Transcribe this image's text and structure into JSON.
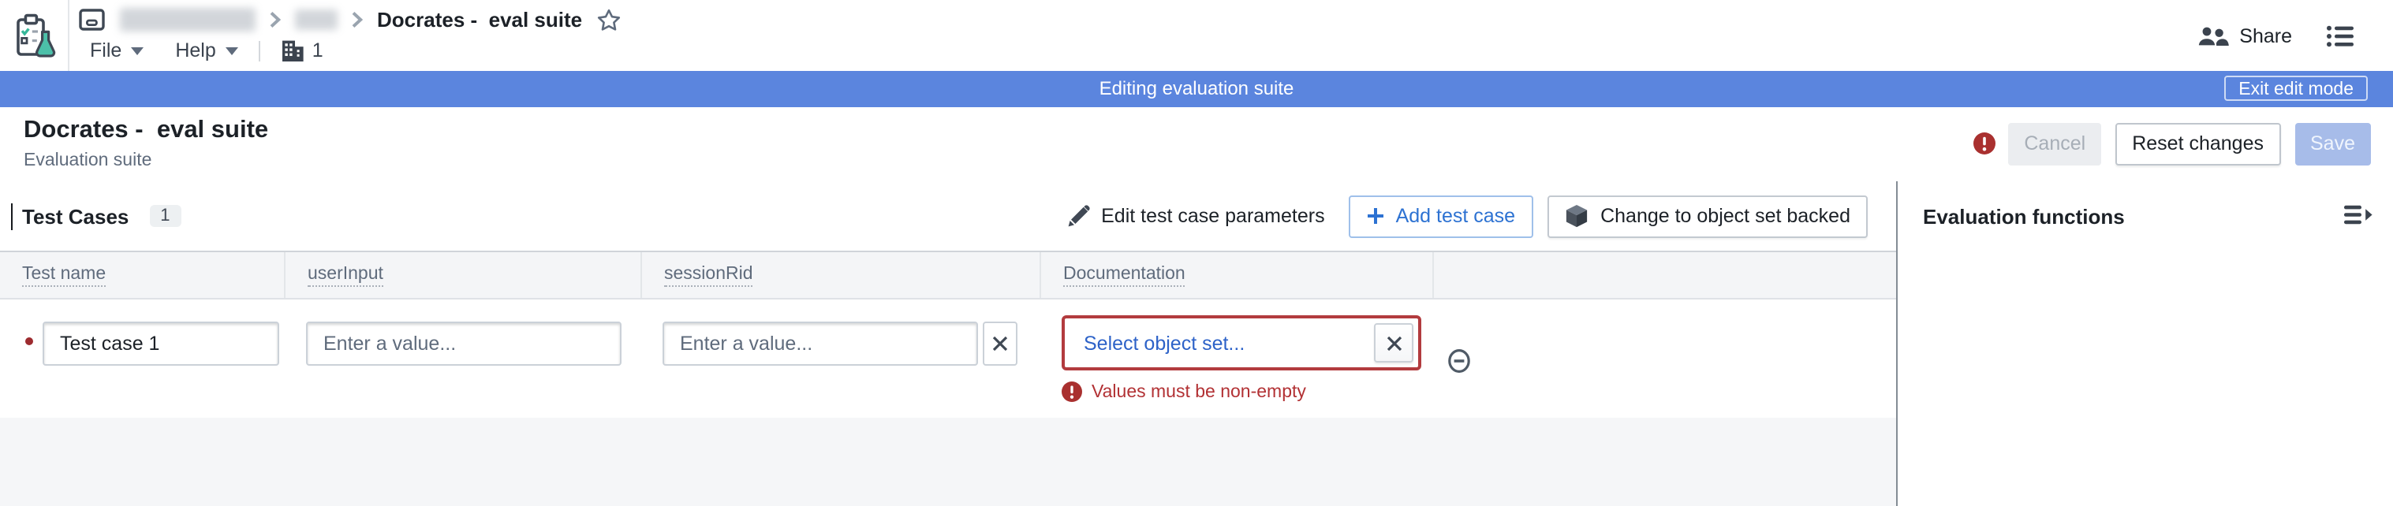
{
  "topbar": {
    "breadcrumb": {
      "title": "Docrates -  eval suite"
    },
    "menu": {
      "file": "File",
      "help": "Help"
    },
    "branch_count": "1",
    "share_label": "Share"
  },
  "banner": {
    "message": "Editing evaluation suite",
    "exit_button": "Exit edit mode"
  },
  "header": {
    "title": "Docrates -  eval suite",
    "subtitle": "Evaluation suite",
    "cancel_button": "Cancel",
    "reset_button": "Reset changes",
    "save_button": "Save"
  },
  "toolbar": {
    "section_title": "Test Cases",
    "test_case_count": "1",
    "edit_params_button": "Edit test case parameters",
    "add_button": "Add test case",
    "change_backed_button": "Change to object set backed"
  },
  "panel": {
    "title": "Evaluation functions"
  },
  "table": {
    "columns": [
      "Test name",
      "userInput",
      "sessionRid",
      "Documentation"
    ],
    "row": {
      "test_name": "Test case 1",
      "user_input_placeholder": "Enter a value...",
      "session_rid_placeholder": "Enter a value...",
      "object_set_placeholder": "Select object set...",
      "error": "Values must be non-empty"
    }
  },
  "colors": {
    "banner_blue": "#5b85de",
    "accent_blue": "#2d72d2",
    "link_blue": "#2d62c8",
    "error_red": "#a9302f",
    "error_border_red": "#b23b3e",
    "logo_teal": "#4cc0a9",
    "header_gray": "#f4f5f7"
  }
}
